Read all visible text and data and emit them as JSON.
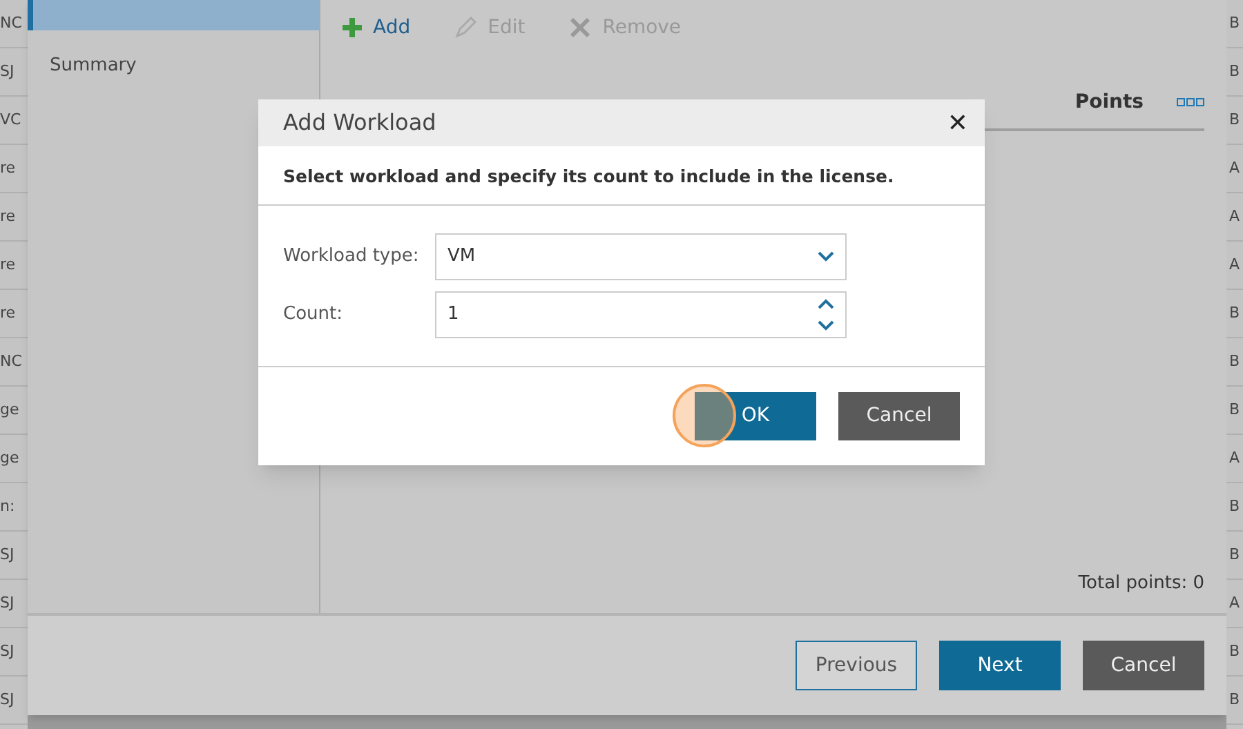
{
  "background_left_column": [
    "NC",
    "SJ",
    "VC",
    "re",
    "re",
    "re",
    "re",
    "NC",
    "ge",
    "ge",
    "n:",
    "SJ",
    "SJ",
    "SJ",
    "SJ"
  ],
  "background_right_column": [
    "B",
    "B",
    "B",
    "A",
    "A",
    "A",
    "B",
    "B",
    "B",
    "A",
    "B",
    "B",
    "A",
    "B",
    "B"
  ],
  "wizard": {
    "sidebar": {
      "items": [
        {
          "selected": true
        },
        {
          "label": "Summary",
          "selected": false
        }
      ]
    },
    "toolbar": [
      {
        "label": "Add",
        "kind": "add",
        "disabled": false
      },
      {
        "label": "Edit",
        "kind": "edit",
        "disabled": true
      },
      {
        "label": "Remove",
        "kind": "remove",
        "disabled": true
      }
    ],
    "table": {
      "columns": [
        {
          "label": "Points"
        }
      ]
    },
    "total": "Total points: 0",
    "buttons": [
      {
        "label": "Previous",
        "kind": "outline"
      },
      {
        "label": "Next",
        "kind": "primary"
      },
      {
        "label": "Cancel",
        "kind": "dark"
      }
    ]
  },
  "dialog": {
    "title": "Add Workload",
    "close": "✕",
    "instruction": "Select workload and specify its count to include in the license.",
    "fields": [
      {
        "label": "Workload type:",
        "value": "VM",
        "kind": "dropdown"
      },
      {
        "label": "Count:",
        "value": "1",
        "kind": "spinner"
      }
    ],
    "buttons": [
      {
        "label": "OK",
        "kind": "primary",
        "highlighted": true
      },
      {
        "label": "Cancel",
        "kind": "dark",
        "highlighted": false
      }
    ]
  }
}
